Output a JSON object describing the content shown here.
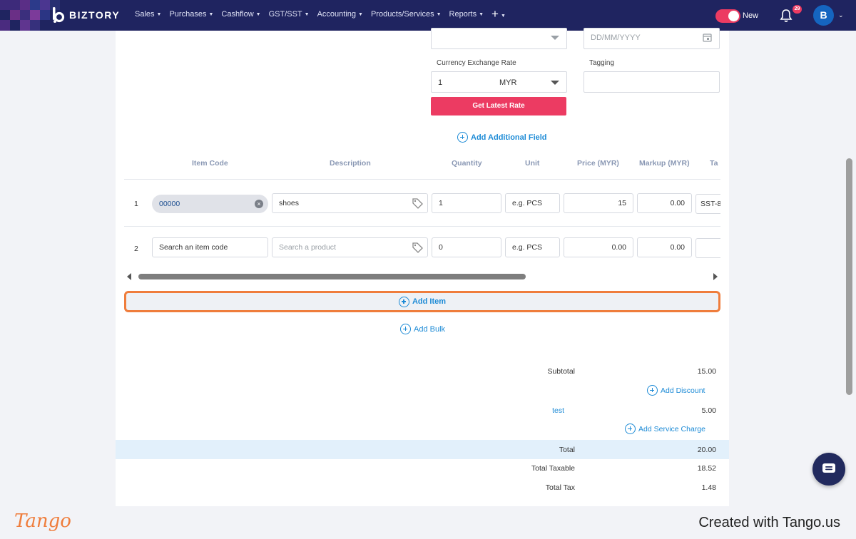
{
  "app": {
    "brand": "BIZTORY",
    "nav": [
      {
        "label": "Sales"
      },
      {
        "label": "Purchases"
      },
      {
        "label": "Cashflow"
      },
      {
        "label": "GST/SST"
      },
      {
        "label": "Accounting"
      },
      {
        "label": "Products/Services"
      },
      {
        "label": "Reports"
      }
    ],
    "new_label": "New",
    "notification_count": "29",
    "avatar_initial": "B"
  },
  "form": {
    "date_placeholder": "DD/MM/YYYY",
    "currency_rate_label": "Currency Exchange Rate",
    "currency_rate_value": "1",
    "currency": "MYR",
    "tagging_label": "Tagging",
    "get_rate_button": "Get Latest Rate",
    "add_field_link": "Add Additional Field"
  },
  "table": {
    "headers": [
      "Item Code",
      "Description",
      "Quantity",
      "Unit",
      "Price (MYR)",
      "Markup (MYR)",
      "Ta"
    ],
    "rows": [
      {
        "num": "1",
        "item_code": "00000",
        "description": "shoes",
        "quantity": "1",
        "unit_placeholder": "e.g. PCS",
        "price": "15",
        "markup": "0.00",
        "tax": "SST-8"
      },
      {
        "num": "2",
        "item_code_placeholder": "Search an item code",
        "description_placeholder": "Search a product",
        "quantity": "0",
        "unit_placeholder": "e.g. PCS",
        "price": "0.00",
        "markup": "0.00",
        "tax": ""
      }
    ],
    "add_item": "Add Item",
    "add_bulk": "Add Bulk"
  },
  "summary": {
    "subtotal_label": "Subtotal",
    "subtotal": "15.00",
    "add_discount": "Add Discount",
    "charge_label": "test",
    "charge": "5.00",
    "add_service_charge": "Add Service Charge",
    "total_label": "Total",
    "total": "20.00",
    "taxable_label": "Total Taxable",
    "taxable": "18.52",
    "tax_label": "Total Tax",
    "tax": "1.48"
  },
  "footer": {
    "logo": "Tango",
    "created": "Created with Tango.us"
  },
  "colors": {
    "nav_bg": "#1f2460",
    "accent_pink": "#ec3b62",
    "link_blue": "#1d8bd6",
    "highlight_orange": "#ef7d3c"
  }
}
